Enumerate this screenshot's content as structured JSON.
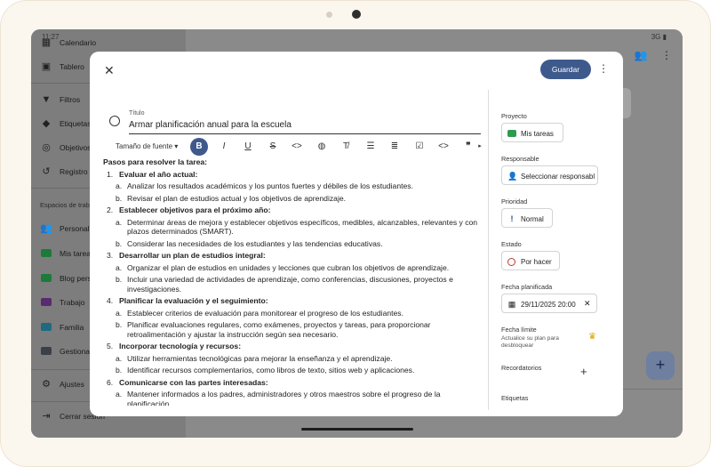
{
  "status_bar": {
    "time": "11:27",
    "signal": "3G"
  },
  "sidebar": {
    "items": [
      {
        "label": "Calendario",
        "icon": "calendar-icon"
      },
      {
        "label": "Tablero",
        "icon": "board-icon"
      },
      {
        "label": "Filtros",
        "icon": "filter-icon"
      },
      {
        "label": "Etiquetas",
        "icon": "tag-icon"
      },
      {
        "label": "Objetivos",
        "icon": "target-icon"
      },
      {
        "label": "Registro d",
        "icon": "history-icon"
      }
    ],
    "section_label": "Espacios de trab",
    "spaces": [
      {
        "label": "Personal",
        "icon": "people-icon",
        "color": "#3a3f48"
      },
      {
        "label": "Mis tarea",
        "icon": "folder-icon",
        "color": "#1e7a3a"
      },
      {
        "label": "Blog pers",
        "icon": "folder-icon",
        "color": "#1e7a3a"
      },
      {
        "label": "Trabajo",
        "icon": "folder-icon",
        "color": "#5a2a6e"
      },
      {
        "label": "Familia",
        "icon": "folder-icon",
        "color": "#1f6a80"
      },
      {
        "label": "Gestiona",
        "icon": "admin-folder-icon",
        "color": "#3a3f48"
      }
    ],
    "footer": [
      {
        "label": "Ajustes",
        "icon": "gear-icon"
      },
      {
        "label": "Cerrar sesión",
        "icon": "logout-icon"
      }
    ]
  },
  "dialog": {
    "save_label": "Guardar",
    "title_label": "Título",
    "title_value": "Armar planificación anual para la escuela",
    "toolbar": {
      "font_size_label": "Tamaño de fuente"
    },
    "content": {
      "heading": "Pasos para resolver la tarea:",
      "steps": [
        {
          "num": "1.",
          "title": "Evaluar el año actual:",
          "subs": [
            "Analizar los resultados académicos y los puntos fuertes y débiles de los estudiantes.",
            "Revisar el plan de estudios actual y los objetivos de aprendizaje."
          ]
        },
        {
          "num": "2.",
          "title": "Establecer objetivos para el próximo año:",
          "subs": [
            "Determinar áreas de mejora y establecer objetivos específicos, medibles, alcanzables, relevantes y con plazos determinados (SMART).",
            "Considerar las necesidades de los estudiantes y las tendencias educativas."
          ]
        },
        {
          "num": "3.",
          "title": "Desarrollar un plan de estudios integral:",
          "subs": [
            "Organizar el plan de estudios en unidades y lecciones que cubran los objetivos de aprendizaje.",
            "Incluir una variedad de actividades de aprendizaje, como conferencias, discusiones, proyectos e investigaciones."
          ]
        },
        {
          "num": "4.",
          "title": "Planificar la evaluación y el seguimiento:",
          "subs": [
            "Establecer criterios de evaluación para monitorear el progreso de los estudiantes.",
            "Planificar evaluaciones regulares, como exámenes, proyectos y tareas, para proporcionar retroalimentación y ajustar la instrucción según sea necesario."
          ]
        },
        {
          "num": "5.",
          "title": "Incorporar tecnología y recursos:",
          "subs": [
            "Utilizar herramientas tecnológicas para mejorar la enseñanza y el aprendizaje.",
            "Identificar recursos complementarios, como libros de texto, sitios web y aplicaciones."
          ]
        },
        {
          "num": "6.",
          "title": "Comunicarse con las partes interesadas:",
          "subs": [
            "Mantener informados a los padres, administradores y otros maestros sobre el progreso de la planificación."
          ]
        }
      ],
      "sub_letters": [
        "a.",
        "b."
      ]
    },
    "right_panel": {
      "project_label": "Proyecto",
      "project_value": "Mis tareas",
      "assignee_label": "Responsable",
      "assignee_value": "Seleccionar responsable",
      "priority_label": "Prioridad",
      "priority_value": "Normal",
      "status_label": "Estado",
      "status_value": "Por hacer",
      "planned_label": "Fecha planificada",
      "planned_value": "29/11/2025 20:00",
      "due_label": "Fecha límite",
      "due_subtext": "Actualice su plan para desbloquear",
      "reminders_label": "Recordatorios",
      "tags_label": "Etiquetas"
    }
  },
  "colors": {
    "accent": "#3e5a8c",
    "folder_green": "#2e9b4f",
    "priority": "#2b4a86",
    "status": "#c0392b"
  }
}
